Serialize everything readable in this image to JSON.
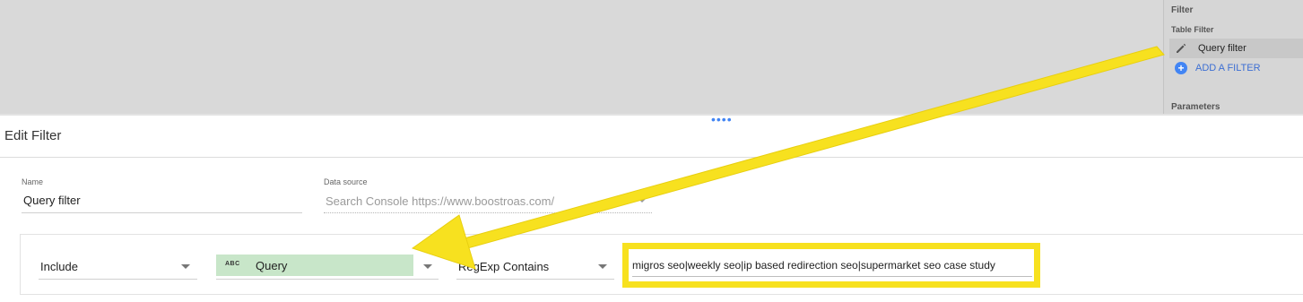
{
  "right_panel": {
    "filter_heading": "Filter",
    "table_filter_heading": "Table Filter",
    "filter_item_label": "Query filter",
    "add_filter_label": "ADD A FILTER",
    "parameters_heading": "Parameters"
  },
  "editor": {
    "title": "Edit Filter",
    "name_label": "Name",
    "name_value": "Query filter",
    "data_source_label": "Data source",
    "data_source_value": "Search Console https://www.boostroas.com/"
  },
  "condition": {
    "include_value": "Include",
    "dimension_type_badge": "ABC",
    "dimension_value": "Query",
    "operator_value": "RegExp Contains",
    "regex_value": "migros seo|weekly seo|ip based redirection seo|supermarket seo case study"
  },
  "annotation": {
    "box_color": "#f7e11f",
    "arrow_color": "#f7e11f"
  },
  "colors": {
    "accent": "#4285f4",
    "dimension_chip": "#c8e6c9",
    "top_area": "#d9d9d9"
  },
  "icons": {
    "edit": "pencil-icon",
    "add": "plus-circle-icon",
    "dropdown": "chevron-down-icon",
    "text_type": "abc-icon"
  }
}
